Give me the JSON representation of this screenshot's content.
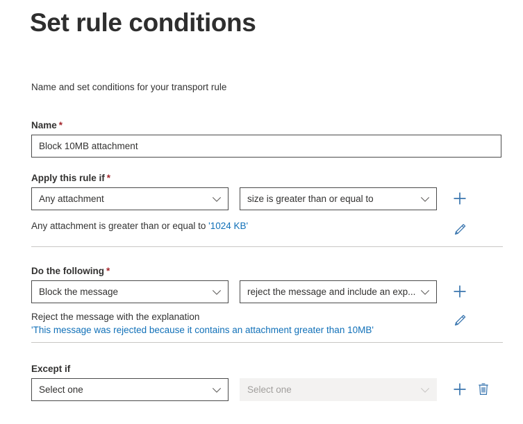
{
  "page": {
    "title": "Set rule conditions",
    "subtitle": "Name and set conditions for your transport rule"
  },
  "colors": {
    "accent": "#1070b8",
    "required_star": "#a4262c",
    "text": "#323130",
    "border": "#4a4a4a",
    "separator": "#c8c6c4",
    "disabled_bg": "#f3f2f1",
    "disabled_text": "#a19f9d"
  },
  "name_field": {
    "label": "Name",
    "required_marker": "*",
    "value": "Block 10MB attachment",
    "placeholder": ""
  },
  "apply_rule_section": {
    "label": "Apply this rule if",
    "required_marker": "*",
    "condition_dropdown": {
      "value": "Any attachment",
      "icon": "chevron-down-icon"
    },
    "operator_dropdown": {
      "value": "size is greater than or equal to",
      "icon": "chevron-down-icon"
    },
    "add_button": {
      "icon": "plus-icon",
      "label": "+"
    },
    "summary": {
      "prefix": "Any attachment is greater than or equal to ",
      "link": "'1024 KB'",
      "edit_button": {
        "icon": "pencil-edit-icon"
      }
    }
  },
  "do_following_section": {
    "label": "Do the following",
    "required_marker": "*",
    "action_dropdown": {
      "value": "Block the message",
      "icon": "chevron-down-icon"
    },
    "action_detail_dropdown": {
      "value": "reject the message and include an exp...",
      "icon": "chevron-down-icon"
    },
    "add_button": {
      "icon": "plus-icon",
      "label": "+"
    },
    "summary": {
      "prefix": "Reject the message with the explanation",
      "link": "'This message was rejected because it contains an attachment greater than 10MB'",
      "edit_button": {
        "icon": "pencil-edit-icon"
      }
    }
  },
  "except_if_section": {
    "label": "Except if",
    "exception_dropdown": {
      "value": "Select one",
      "icon": "chevron-down-icon"
    },
    "exception_detail_dropdown": {
      "value": "Select one",
      "icon": "chevron-down-icon",
      "disabled": true
    },
    "add_button": {
      "icon": "plus-icon",
      "label": "+"
    },
    "delete_button": {
      "icon": "trash-delete-icon"
    }
  }
}
